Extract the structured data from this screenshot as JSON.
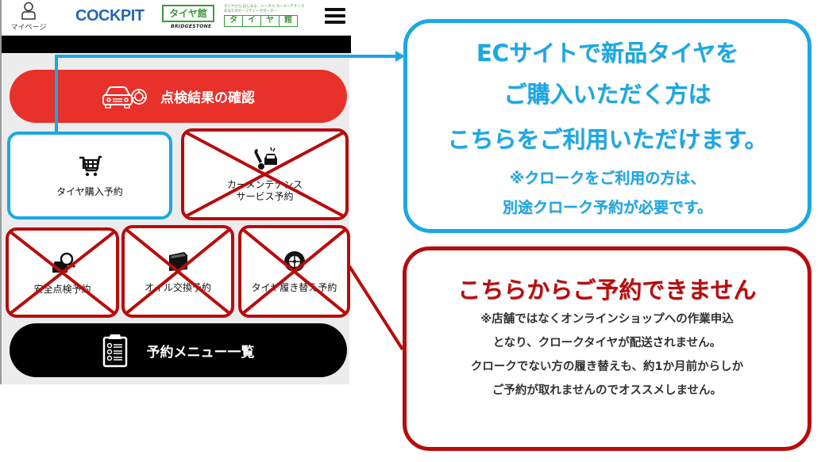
{
  "header": {
    "mypage_label": "マイページ",
    "logo_cockpit": "COCKPIT",
    "logo_taiyakan": "タイヤ館",
    "logo_bridgestone": "BRIDGESTONE",
    "logo_taiyakan2_tagline1": "タイヤから はじまる、トータル カーメンテナンス",
    "logo_taiyakan2_tagline2": "あなたのセーフティーサポーター",
    "logo_taiyakan2_chars": [
      "タ",
      "イ",
      "ヤ",
      "館"
    ]
  },
  "menu": {
    "inspection_results": "点検結果の確認",
    "tiles": [
      {
        "label": "タイヤ購入予約",
        "icon": "cart-icon",
        "status": "available"
      },
      {
        "label": "カーメンテナンス\nサービス予約",
        "icon": "car-repair-icon",
        "status": "unavailable"
      },
      {
        "label": "安全点検予約",
        "icon": "car-inspection-icon",
        "status": "unavailable"
      },
      {
        "label": "オイル交換予約",
        "icon": "oil-can-icon",
        "status": "unavailable"
      },
      {
        "label": "タイヤ履き替え予約",
        "icon": "tire-icon",
        "status": "unavailable"
      }
    ],
    "reservation_list": "予約メニュー一覧"
  },
  "callout_available": {
    "lines": [
      "ECサイトで新品タイヤを",
      "ご購入いただく方は",
      "こちらをご利用いただけます。"
    ],
    "notes": [
      "※クロークをご利用の方は、",
      "別途クローク予約が必要です。"
    ],
    "color": "#1aa8e4"
  },
  "callout_unavailable": {
    "title": "こちらからご予約できません",
    "lines": [
      "※店舗ではなくオンラインショップへの作業申込",
      "となり、クロークタイヤが配送されません。",
      "クロークでない方の履き替えも、約1か月前からしか",
      "ご予約が取れませんのでオススメしません。"
    ],
    "color": "#b80c0c"
  }
}
